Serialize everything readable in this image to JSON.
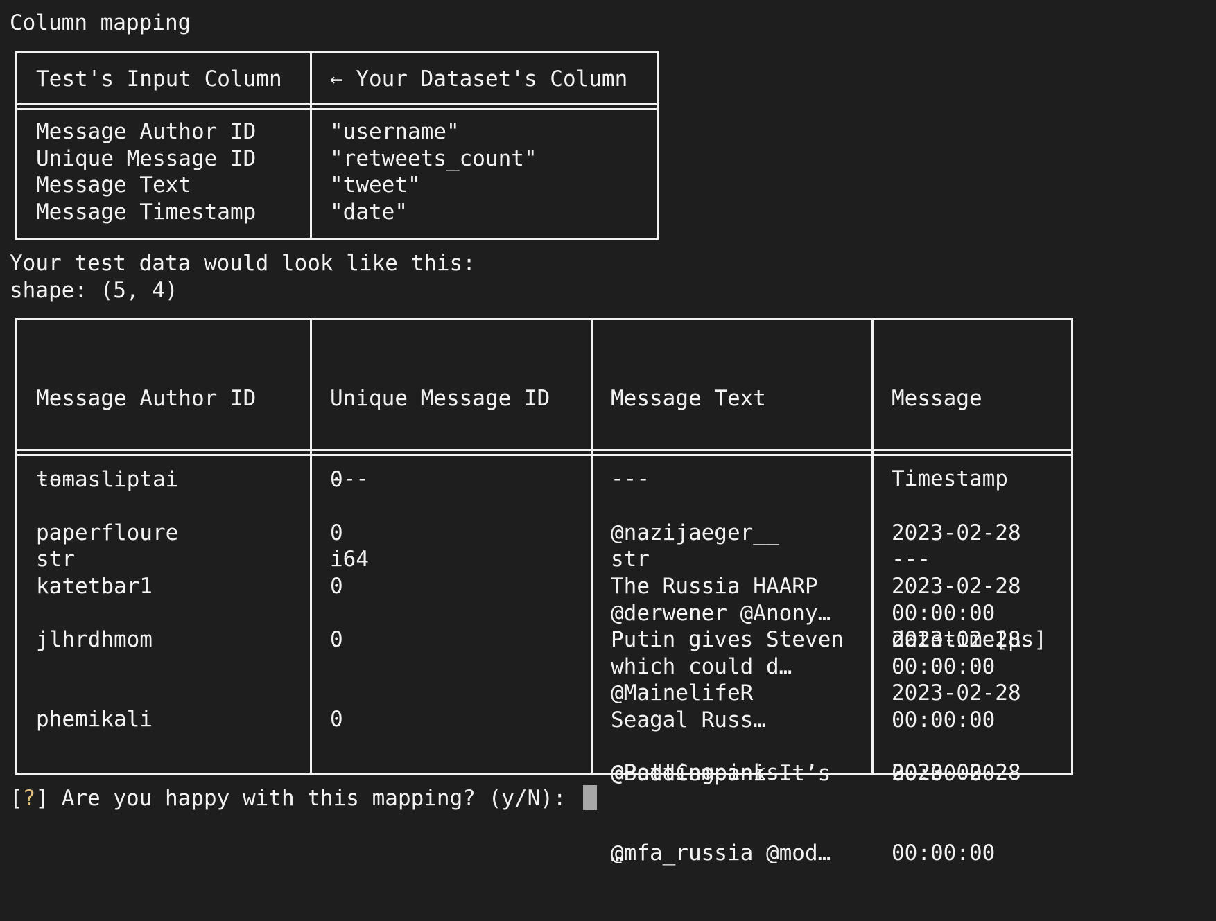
{
  "heading": "Column mapping",
  "mapping_table": {
    "headers": [
      "Test's Input Column",
      "← Your Dataset's Column"
    ],
    "rows": [
      [
        "Message Author ID",
        "\"username\""
      ],
      [
        "Unique Message ID",
        "\"retweets_count\""
      ],
      [
        "Message Text",
        "\"tweet\""
      ],
      [
        "Message Timestamp",
        "\"date\""
      ]
    ]
  },
  "preview_intro": "Your test data would look like this:",
  "shape_line": "shape: (5, 4)",
  "data_table": {
    "columns": [
      {
        "name": "Message Author ID",
        "name_lines": [
          "Message Author ID"
        ],
        "sep": "---",
        "dtype": "str"
      },
      {
        "name": "Unique Message ID",
        "name_lines": [
          "Unique Message ID"
        ],
        "sep": "---",
        "dtype": "i64"
      },
      {
        "name": "Message Text",
        "name_lines": [
          "Message Text"
        ],
        "sep": "---",
        "dtype": "str"
      },
      {
        "name": "Message Timestamp",
        "name_lines": [
          "Message",
          "Timestamp"
        ],
        "sep": "---",
        "dtype": "datetime[μs]"
      }
    ],
    "rows": [
      {
        "author": "tomasliptai",
        "id": "0",
        "text": [
          "@nazijaeger__",
          "@derwener @Anony…"
        ],
        "ts": [
          "2023-02-28",
          "00:00:00"
        ]
      },
      {
        "author": "paperfloure",
        "id": "0",
        "text": [
          "The Russia HAARP",
          "which could d…"
        ],
        "ts": [
          "2023-02-28",
          "00:00:00"
        ]
      },
      {
        "author": "katetbar1",
        "id": "0",
        "text": [
          "Putin gives Steven",
          "Seagal Russ…"
        ],
        "ts": [
          "2023-02-28",
          "00:00:00"
        ]
      },
      {
        "author": "jlhrdhmom",
        "id": "0",
        "text": [
          "@MainelifeR",
          "@BaddCompani It’s",
          "…"
        ],
        "ts": [
          "2023-02-28",
          "00:00:00"
        ]
      },
      {
        "author": "phemikali",
        "id": "0",
        "text": [
          "@Pottingpinks",
          "@mfa_russia @mod…"
        ],
        "ts": [
          "2023-02-28",
          "00:00:00"
        ]
      }
    ]
  },
  "prompt": {
    "open_bracket": "[",
    "marker": "?",
    "close_bracket": "]",
    "question": "Are you happy with this mapping? (y/N):"
  },
  "colors": {
    "background": "#1e1e1e",
    "text": "#f2f2f2",
    "prompt_marker": "#e5c07b",
    "cursor": "#a7a7a7"
  }
}
